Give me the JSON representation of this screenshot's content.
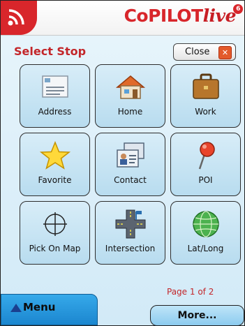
{
  "header": {
    "brand_main": "CoPILOT",
    "brand_live": "live",
    "brand_version": "6"
  },
  "screen": {
    "title": "Select Stop",
    "close_label": "Close"
  },
  "tiles": [
    {
      "label": "Address",
      "icon": "address-card-icon"
    },
    {
      "label": "Home",
      "icon": "home-icon"
    },
    {
      "label": "Work",
      "icon": "briefcase-icon"
    },
    {
      "label": "Favorite",
      "icon": "star-icon"
    },
    {
      "label": "Contact",
      "icon": "contact-cards-icon"
    },
    {
      "label": "POI",
      "icon": "map-pin-icon"
    },
    {
      "label": "Pick On Map",
      "icon": "crosshair-icon"
    },
    {
      "label": "Intersection",
      "icon": "intersection-icon"
    },
    {
      "label": "Lat/Long",
      "icon": "globe-icon"
    }
  ],
  "footer": {
    "page_info": "Page 1 of 2",
    "menu_label": "Menu",
    "more_label": "More..."
  },
  "colors": {
    "accent_red": "#d8262b",
    "tile_blue": "#b8dcef",
    "menu_blue": "#1b86cf"
  }
}
